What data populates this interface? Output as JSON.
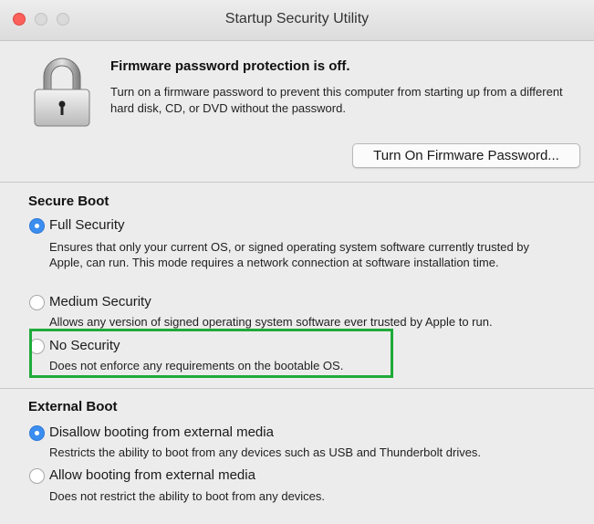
{
  "window": {
    "title": "Startup Security Utility"
  },
  "firmware": {
    "status_title": "Firmware password protection is off.",
    "description": "Turn on a firmware password to prevent this computer from starting up from a different hard disk, CD, or DVD without the password.",
    "button_label": "Turn On Firmware Password...",
    "icon": "lock-icon"
  },
  "secure_boot": {
    "title": "Secure Boot",
    "selected": "Full Security",
    "options": [
      {
        "label": "Full Security",
        "description": "Ensures that only your current OS, or signed operating system software currently trusted by Apple, can run. This mode requires a network connection at software installation time.",
        "checked": true
      },
      {
        "label": "Medium Security",
        "description": "Allows any version of signed operating system software ever trusted by Apple to run.",
        "checked": false
      },
      {
        "label": "No Security",
        "description": "Does not enforce any requirements on the bootable OS.",
        "checked": false
      }
    ]
  },
  "external_boot": {
    "title": "External Boot",
    "selected": "Disallow booting from external media",
    "options": [
      {
        "label": "Disallow booting from external media",
        "description": "Restricts the ability to boot from any devices such as USB and Thunderbolt drives.",
        "checked": true
      },
      {
        "label": "Allow booting from external media",
        "description": "Does not restrict the ability to boot from any devices.",
        "checked": false
      }
    ]
  },
  "colors": {
    "radio_selected": "#3b8ef0",
    "close_button": "#fc605b",
    "highlight_box": "#1faa3a"
  }
}
